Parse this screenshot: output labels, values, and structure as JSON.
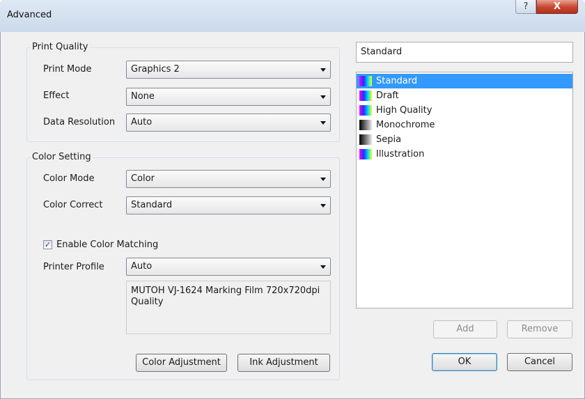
{
  "window": {
    "title": "Advanced",
    "help_glyph": "?",
    "close_glyph": "X"
  },
  "print_quality": {
    "legend": "Print Quality",
    "print_mode": {
      "label": "Print Mode",
      "value": "Graphics 2"
    },
    "effect": {
      "label": "Effect",
      "value": "None"
    },
    "data_resolution": {
      "label": "Data Resolution",
      "value": "Auto"
    }
  },
  "color_setting": {
    "legend": "Color Setting",
    "color_mode": {
      "label": "Color Mode",
      "value": "Color"
    },
    "color_correct": {
      "label": "Color Correct",
      "value": "Standard"
    },
    "enable_matching": {
      "label": "Enable Color Matching",
      "checked": true
    },
    "printer_profile": {
      "label": "Printer Profile",
      "value": "Auto"
    },
    "profile_description": "MUTOH VJ-1624 Marking Film 720x720dpi Quality",
    "color_adjustment_label": "Color Adjustment",
    "ink_adjustment_label": "Ink Adjustment"
  },
  "presets": {
    "name_value": "Standard",
    "items": [
      {
        "label": "Standard",
        "icon": "color-gradient-icon",
        "selected": true
      },
      {
        "label": "Draft",
        "icon": "color-gradient-icon",
        "selected": false
      },
      {
        "label": "High Quality",
        "icon": "color-gradient-icon",
        "selected": false
      },
      {
        "label": "Monochrome",
        "icon": "grayscale-gradient-icon",
        "selected": false
      },
      {
        "label": "Sepia",
        "icon": "grayscale-gradient-icon",
        "selected": false
      },
      {
        "label": "Illustration",
        "icon": "color-gradient-icon",
        "selected": false
      }
    ],
    "add_label": "Add",
    "remove_label": "Remove"
  },
  "footer": {
    "ok_label": "OK",
    "cancel_label": "Cancel"
  }
}
